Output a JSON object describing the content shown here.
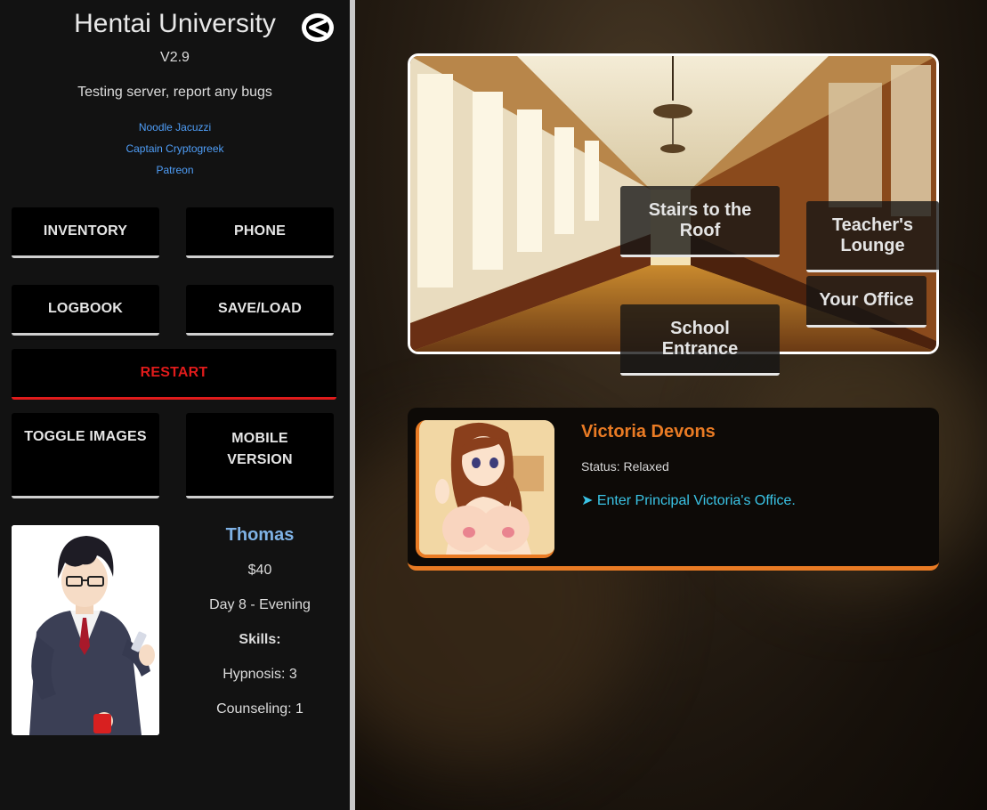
{
  "app": {
    "title": "Hentai University",
    "version": "V2.9",
    "notice": "Testing server, report any bugs"
  },
  "credits": [
    "Noodle Jacuzzi",
    "Captain Cryptogreek",
    "Patreon"
  ],
  "menu": {
    "inventory": "INVENTORY",
    "phone": "PHONE",
    "logbook": "LOGBOOK",
    "save_load": "SAVE/LOAD",
    "restart": "RESTART",
    "toggle_images": "TOGGLE IMAGES",
    "mobile_version_line1": "MOBILE",
    "mobile_version_line2": "VERSION"
  },
  "player": {
    "name": "Thomas",
    "money": "$40",
    "time": "Day 8 - Evening",
    "skills_label": "Skills:",
    "skill_hypnosis": "Hypnosis: 3",
    "skill_counseling": "Counseling: 1"
  },
  "locations": {
    "stairs_line1": "Stairs to the",
    "stairs_line2": "Roof",
    "teachers_line1": "Teacher's",
    "teachers_line2": "Lounge",
    "office": "Your Office",
    "entrance_line1": "School",
    "entrance_line2": "Entrance"
  },
  "character": {
    "name": "Victoria Devons",
    "status": "Status: Relaxed",
    "action": "➤ Enter Principal Victoria's Office."
  },
  "colors": {
    "accent_orange": "#e97b24",
    "link_blue": "#4f9ef8",
    "restart_red": "#e01b1b",
    "player_name": "#7fb2e5",
    "action_cyan": "#3ac4e6"
  },
  "icons": {
    "back": "back-arrow-icon"
  }
}
